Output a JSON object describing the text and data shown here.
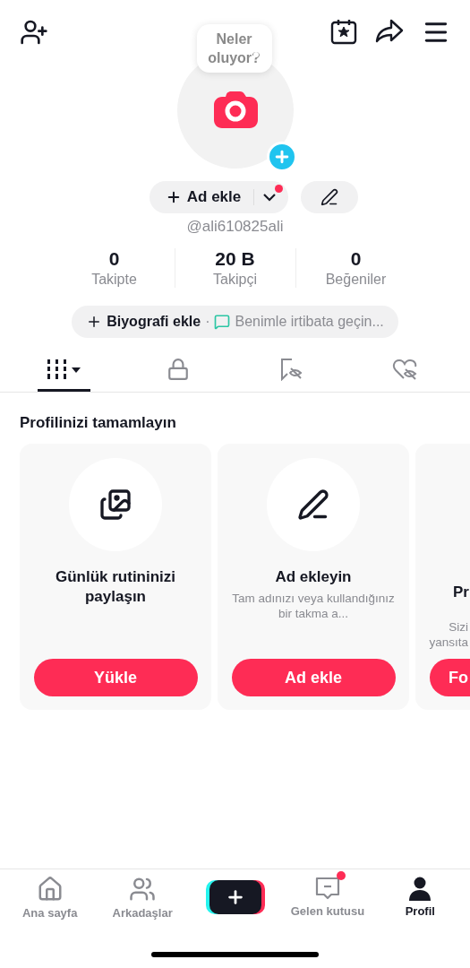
{
  "header": {
    "bubble": "Neler oluyor?"
  },
  "profile": {
    "add_name_button": {
      "label": "Ad ekle",
      "notification_dot": true
    },
    "username": "@ali610825ali"
  },
  "stats": [
    {
      "value": "0",
      "label": "Takipte"
    },
    {
      "value": "20 B",
      "label": "Takipçi"
    },
    {
      "value": "0",
      "label": "Beğeniler"
    }
  ],
  "bio": {
    "add_label": "Biyografi ekle",
    "separator": "·",
    "contact": "Benimle irtibata geçin..."
  },
  "tabs": [
    {
      "kind": "videos",
      "selected": true
    },
    {
      "kind": "private",
      "selected": false
    },
    {
      "kind": "reposts",
      "selected": false
    },
    {
      "kind": "liked",
      "selected": false
    }
  ],
  "section_title": "Profilinizi tamamlayın",
  "cards": [
    {
      "kind": "photos",
      "title": "Günlük rutininizi paylaşın",
      "button": "Yükle"
    },
    {
      "kind": "name",
      "title": "Ad ekleyin",
      "description": "Tam adınızı veya kullandığınız bir takma a...",
      "button": "Ad ekle"
    },
    {
      "kind": "partial",
      "title": "Pr",
      "description_lines": [
        "Sizi",
        "yansıta"
      ],
      "button": "Fo"
    }
  ],
  "nav": [
    {
      "kind": "home",
      "label": "Ana sayfa",
      "selected": false,
      "badge": false
    },
    {
      "kind": "friends",
      "label": "Arkadaşlar",
      "selected": false,
      "badge": false
    },
    {
      "kind": "create",
      "selected": false
    },
    {
      "kind": "inbox",
      "label": "Gelen kutusu",
      "selected": false,
      "badge": true
    },
    {
      "kind": "profile",
      "label": "Profil",
      "selected": true,
      "badge": false
    }
  ]
}
